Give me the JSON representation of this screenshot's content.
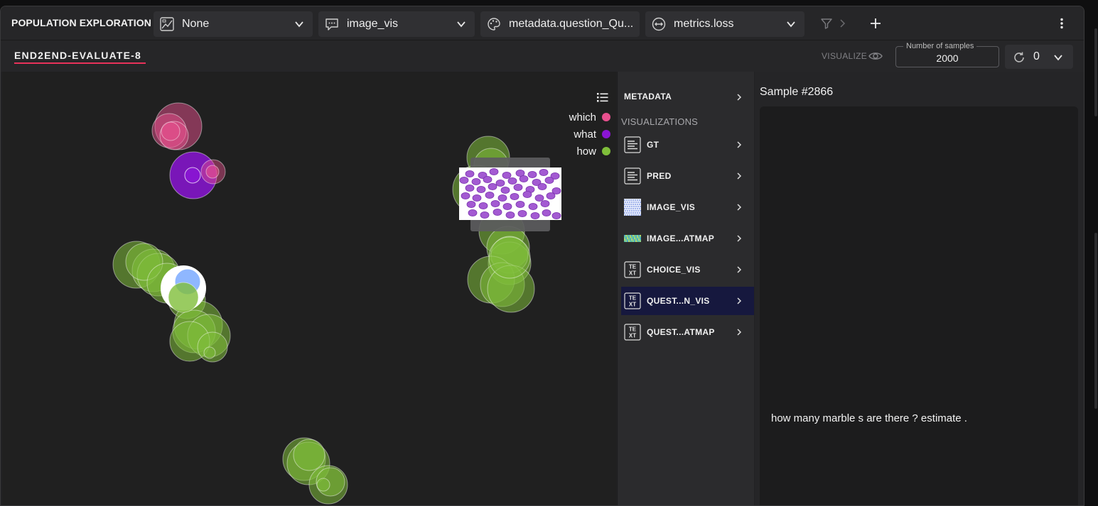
{
  "toolbar": {
    "title": "POPULATION EXPLORATION",
    "dropdowns": [
      {
        "label": "None",
        "icon": "image-chart-icon"
      },
      {
        "label": "image_vis",
        "icon": "comment-icon"
      },
      {
        "label": "metadata.question_Qu...",
        "icon": "palette-icon"
      },
      {
        "label": "metrics.loss",
        "icon": "resize-horizontal-icon"
      }
    ],
    "icons": [
      "filter-icon",
      "chevron-right-icon",
      "plus-icon",
      "more-vertical-icon"
    ]
  },
  "subbar": {
    "tab_name": "END2END-EVALUATE-8",
    "visualize_label": "VISUALIZE",
    "samples_label": "Number of samples",
    "samples_value": "2000",
    "version_value": "0"
  },
  "legend": [
    {
      "label": "which",
      "color": "#e8508e"
    },
    {
      "label": "what",
      "color": "#8a15d4"
    },
    {
      "label": "how",
      "color": "#7fbe3a"
    }
  ],
  "middle": {
    "metadata_label": "METADATA",
    "visualizations_label": "VISUALIZATIONS",
    "items": [
      {
        "label": "GT",
        "icon": "text-lines-icon"
      },
      {
        "label": "PRED",
        "icon": "text-lines-icon"
      },
      {
        "label": "IMAGE_VIS",
        "icon": "image-thumbnail-icon"
      },
      {
        "label": "IMAGE...ATMAP",
        "icon": "heatmap-thumbnail-icon"
      },
      {
        "label": "CHOICE_VIS",
        "icon": "text-box-icon"
      },
      {
        "label": "QUEST...N_VIS",
        "icon": "text-box-icon",
        "active": true
      },
      {
        "label": "QUEST...ATMAP",
        "icon": "text-box-icon"
      }
    ],
    "text_icon_top": "TE",
    "text_icon_bottom": "XT"
  },
  "right": {
    "sample_title": "Sample #2866",
    "sample_text": "how many marble s are there ? estimate ."
  }
}
